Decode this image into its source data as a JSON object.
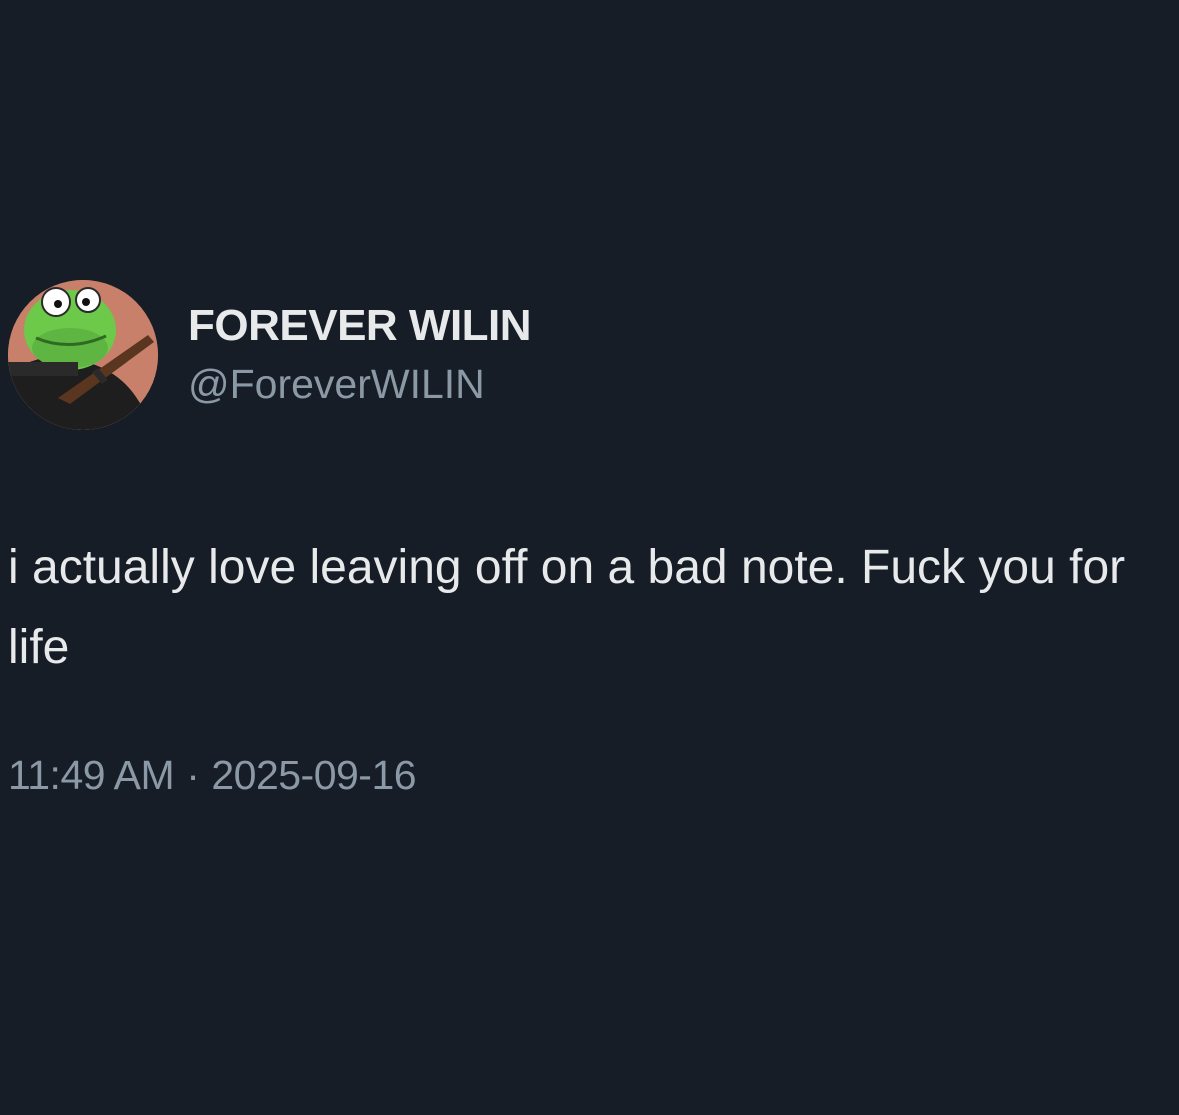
{
  "tweet": {
    "author": {
      "display_name": "FOREVER WILIN",
      "handle": "@ForeverWILIN"
    },
    "text": "i actually love leaving off on a bad note. Fuck you for life",
    "time": "11:49 AM",
    "separator": "·",
    "date": "2025-09-16"
  },
  "colors": {
    "background": "#161d26",
    "primary_text": "#e7e9ea",
    "secondary_text": "#8b98a5"
  }
}
